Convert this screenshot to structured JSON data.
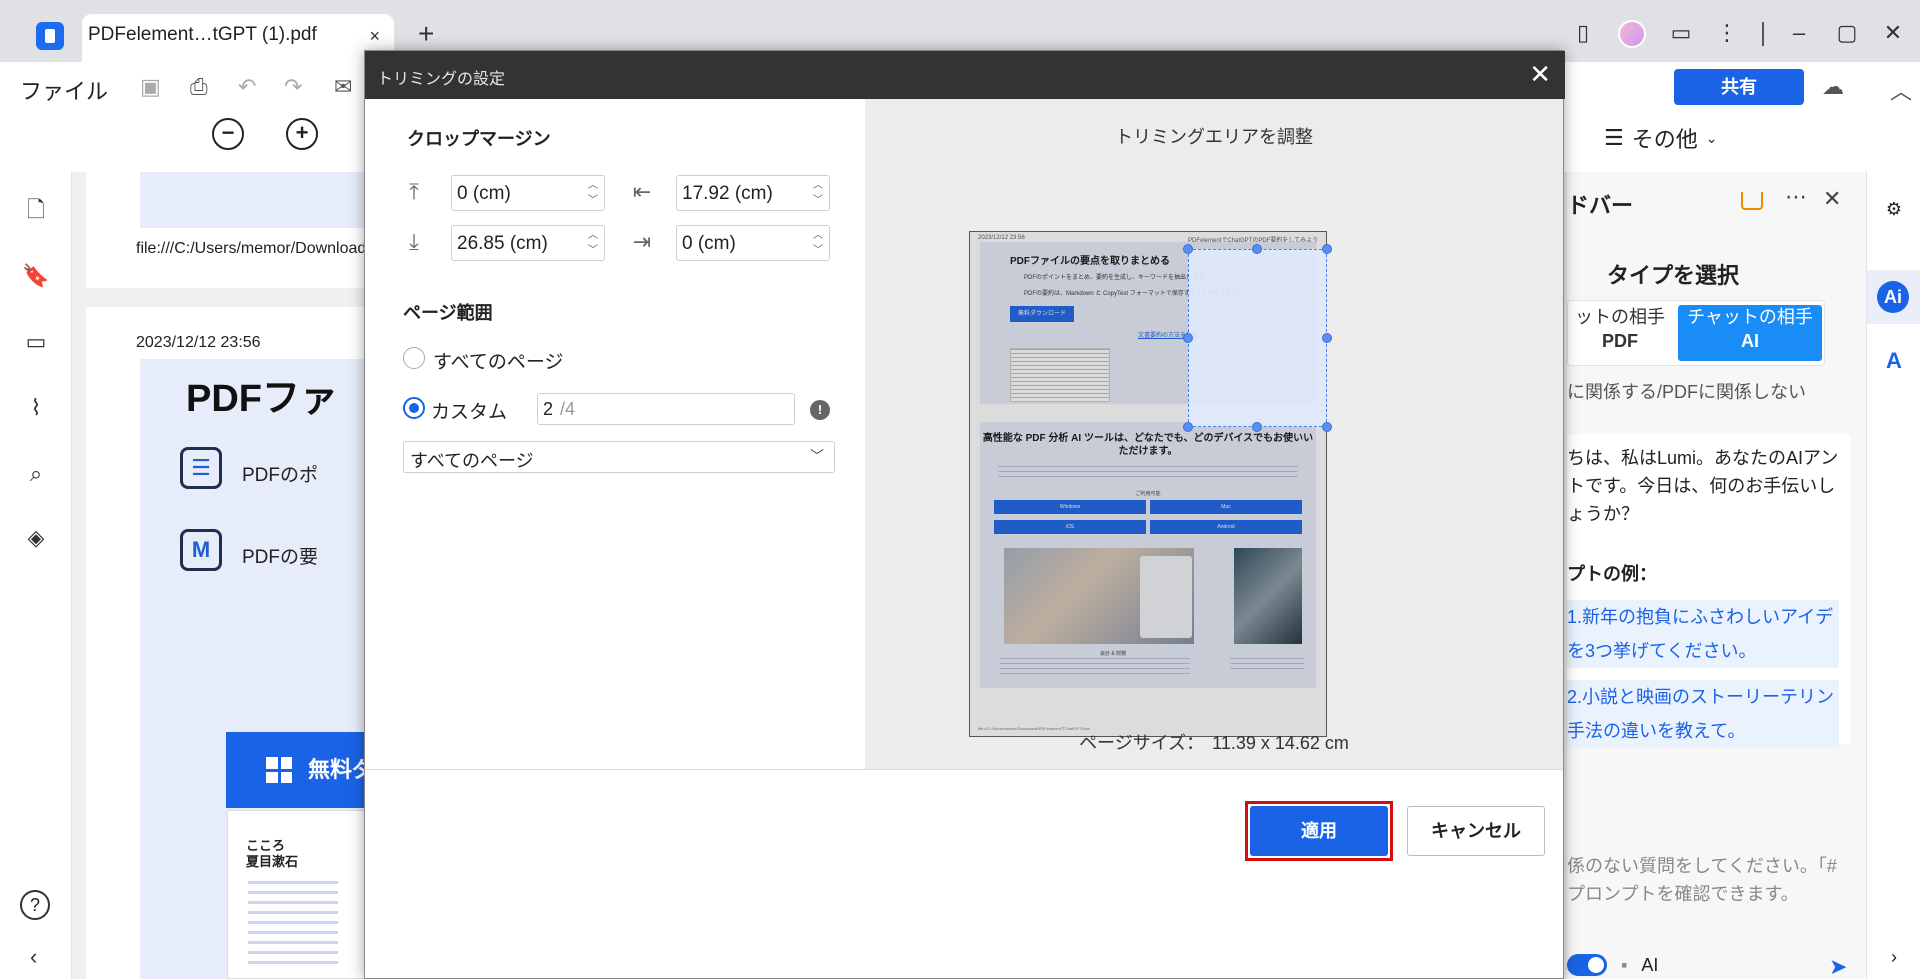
{
  "tab": {
    "title": "PDFelement…tGPT (1).pdf",
    "close": "×",
    "add": "+"
  },
  "toolbar": {
    "file_menu": "ファイル",
    "share_label": "共有",
    "more_label": "その他"
  },
  "document": {
    "page1_url": "file:///C:/Users/memor/Download",
    "page2_date": "2023/12/12 23:56",
    "page2_title": "PDFファ",
    "page2_line1": "PDFのポ",
    "page2_line2": "PDFの要",
    "page2_button": "無料ダ",
    "thumb_title1": "こころ",
    "thumb_title2": "夏目漱石"
  },
  "modal": {
    "title": "トリミングの設定",
    "crop_margin_heading": "クロップマージン",
    "margin_top": "0 (cm)",
    "margin_left": "17.92 (cm)",
    "margin_bottom": "26.85 (cm)",
    "margin_right": "0 (cm)",
    "page_range_heading": "ページ範囲",
    "all_pages_label": "すべてのページ",
    "custom_label": "カスタム",
    "custom_value": "2",
    "custom_total": "/4",
    "select_value": "すべてのページ",
    "preview_title": "トリミングエリアを調整",
    "page_size_label": "ページサイズ：",
    "page_size_value": "11.39 x 14.62 cm",
    "apply_label": "適用",
    "cancel_label": "キャンセル"
  },
  "preview": {
    "header_left": "2023/12/12 23:56",
    "header_right": "PDFelementでChatGPTのPDF要約をしてみよう",
    "block1_title": "PDFファイルの要点を取りまとめる",
    "block1_line1": "PDFのポイントをまとめ、要約を生成し、キーワードを抽出します。",
    "block1_line2": "PDFの要約は、Markdown と CopyText フォーマットで保存することができます。",
    "block1_button": "無料ダウンロード",
    "block1_link": "文書要約の方法を確認",
    "block2_title": "高性能な PDF 分析 AI ツールは、どなたでも、どのデバイスでもお使いいただけます。",
    "block2_sub": "ご利用可能",
    "os_windows": "Windows",
    "os_mac": "Mac",
    "os_ios": "iOS",
    "os_android": "Android",
    "caption": "会計 & 財務",
    "footer": "file:///C:/Users/memor/Downloads/PDFelementでChatGPT.html"
  },
  "sidebar": {
    "title": "ドバー",
    "type_heading": "タイプを選択",
    "seg_a_line1": "ットの相手",
    "seg_a_line2": "PDF",
    "seg_b_line1": "チャットの相手",
    "seg_b_line2": "AI",
    "toggle_text": "に関係する/PDFに関係しない",
    "greeting": "ちは、私はLumi。あなたのAIアントです。今日は、何のお手伝いしょうか？",
    "examples_heading": "プトの例：",
    "example1": "1.新年の抱負にふさわしいアイデを3つ挙げてください。",
    "example2": "2.小説と映画のストーリーテリン手法の違いを教えて。",
    "input_hint": "係のない質問をしてください。「#プロンプトを確認できます。",
    "ai_label": "AI"
  }
}
